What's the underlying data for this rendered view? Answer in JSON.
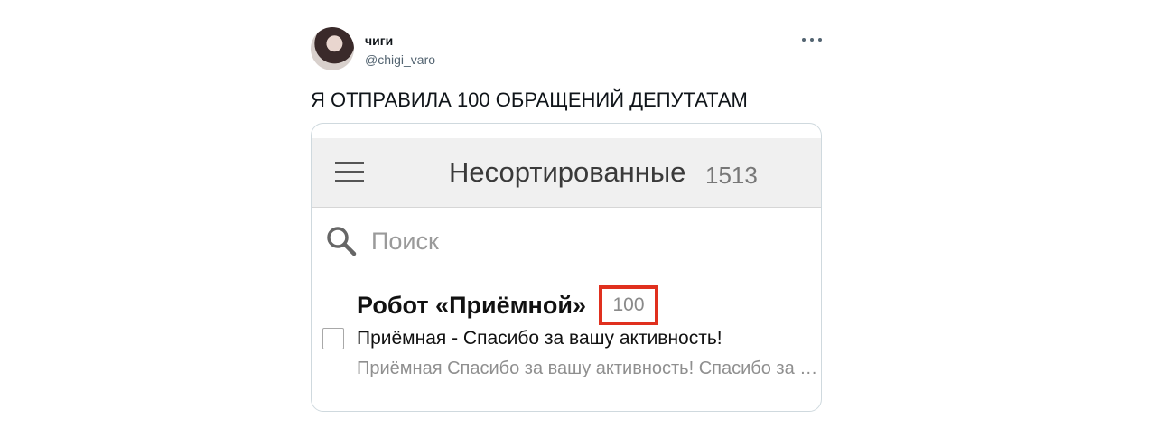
{
  "tweet": {
    "display_name": "чиги",
    "handle": "@chigi_varo",
    "text": "Я ОТПРАВИЛА 100 ОБРАЩЕНИЙ ДЕПУТАТАМ",
    "more_icon": "more-horizontal-icon"
  },
  "mail_app": {
    "title": "Несортированные",
    "count": "1513",
    "menu_icon": "hamburger-menu-icon",
    "search": {
      "icon": "search-icon",
      "placeholder": "Поиск"
    },
    "messages": [
      {
        "sender": "Робот «Приёмной»",
        "thread_count": "100",
        "subject": "Приёмная - Спасибо за вашу активность!",
        "snippet": "Приёмная Спасибо за вашу активность! Спасибо за вашу активность",
        "highlight_color": "#e0301e"
      }
    ]
  }
}
